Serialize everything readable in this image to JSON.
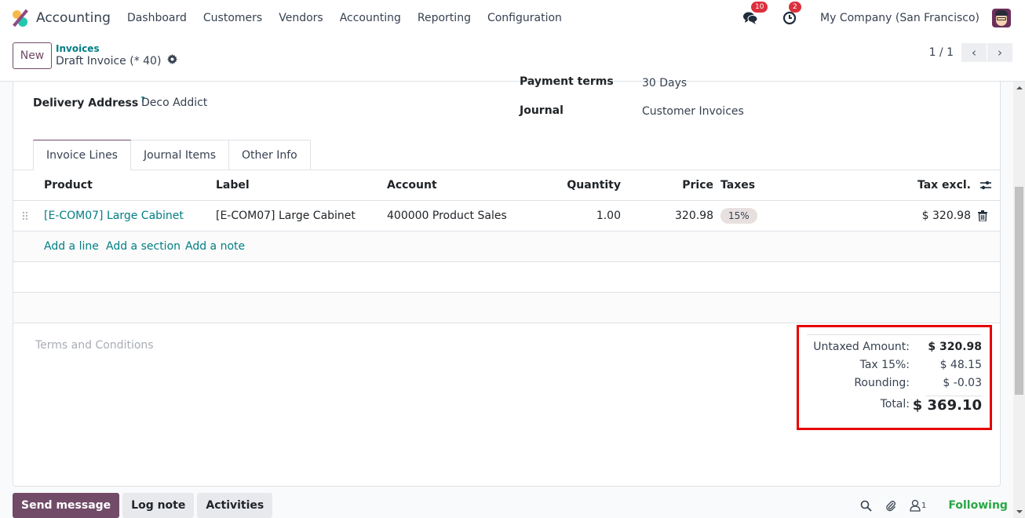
{
  "navbar": {
    "app_name": "Accounting",
    "menu": [
      "Dashboard",
      "Customers",
      "Vendors",
      "Accounting",
      "Reporting",
      "Configuration"
    ],
    "messages_count": "10",
    "activities_count": "2",
    "company": "My Company (San Francisco)"
  },
  "control": {
    "new_label": "New",
    "breadcrumb_parent": "Invoices",
    "breadcrumb_current": "Draft Invoice (* 40)",
    "pager_value": "1 / 1",
    "prev_icon": "‹",
    "next_icon": "›"
  },
  "form": {
    "payment_terms_label": "Payment terms",
    "payment_terms_value": "30 Days",
    "delivery_address_label": "Delivery Address",
    "delivery_address_help": "?",
    "delivery_address_value": "Deco Addict",
    "journal_label": "Journal",
    "journal_value": "Customer Invoices"
  },
  "tabs": [
    {
      "label": "Invoice Lines",
      "active": true
    },
    {
      "label": "Journal Items",
      "active": false
    },
    {
      "label": "Other Info",
      "active": false
    }
  ],
  "lines": {
    "headers": {
      "product": "Product",
      "label": "Label",
      "account": "Account",
      "quantity": "Quantity",
      "price": "Price",
      "taxes": "Taxes",
      "tax_excl": "Tax excl."
    },
    "rows": [
      {
        "product": "[E-COM07] Large Cabinet",
        "label": "[E-COM07] Large Cabinet",
        "account": "400000 Product Sales",
        "quantity": "1.00",
        "price": "320.98",
        "taxes": "15%",
        "tax_excl": "$ 320.98"
      }
    ],
    "actions": {
      "add_line": "Add a line",
      "add_section": "Add a section",
      "add_note": "Add a note"
    }
  },
  "terms_placeholder": "Terms and Conditions",
  "totals": {
    "untaxed_label": "Untaxed Amount:",
    "untaxed_value": "$ 320.98",
    "tax_label": "Tax 15%:",
    "tax_value": "$ 48.15",
    "rounding_label": "Rounding:",
    "rounding_value": "$ -0.03",
    "total_label": "Total:",
    "total_value": "$ 369.10",
    "highlight_color": "#e60000"
  },
  "chatter": {
    "send_message": "Send message",
    "log_note": "Log note",
    "activities": "Activities",
    "followers_count": "1",
    "following": "Following"
  },
  "colors": {
    "primary": "#714b67",
    "link": "#017e84",
    "badge": "#dc2f3c",
    "following": "#28a745"
  }
}
